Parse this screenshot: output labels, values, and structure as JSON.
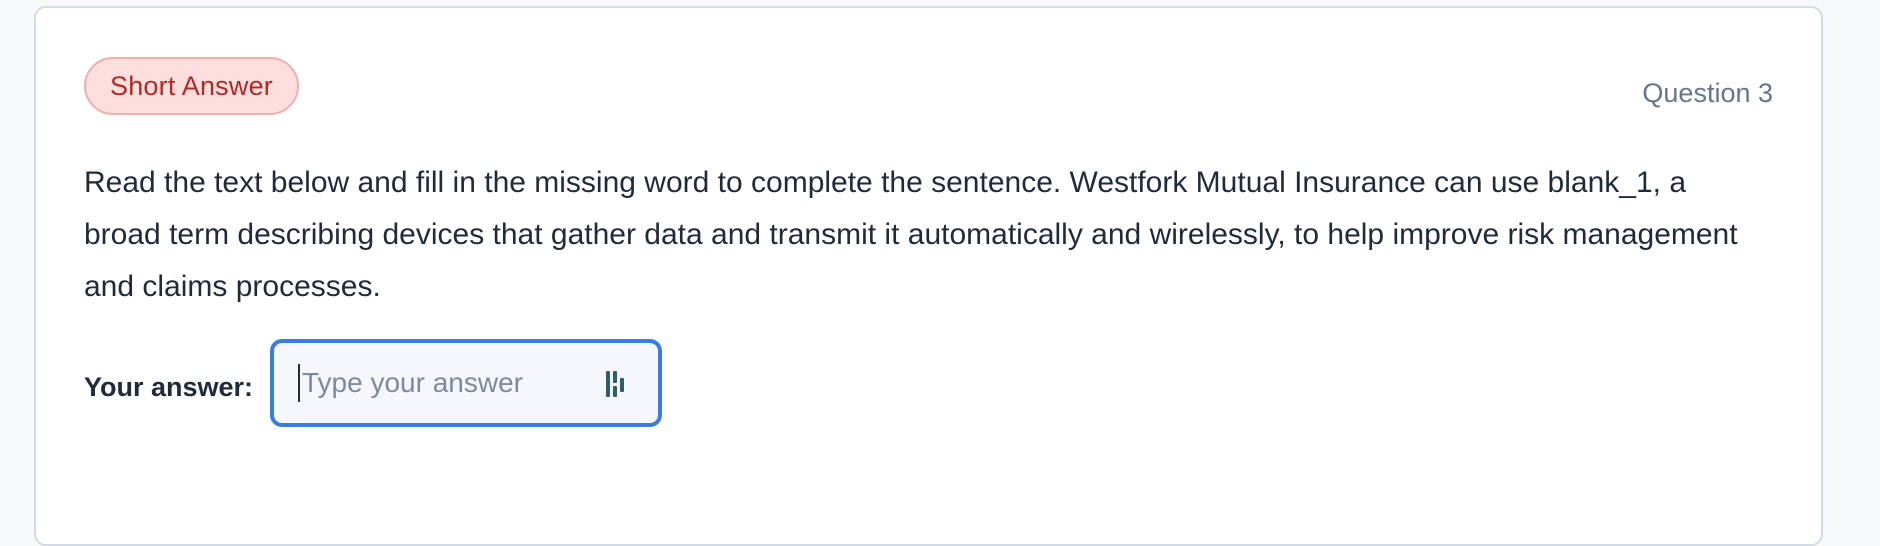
{
  "question": {
    "type_badge": "Short Answer",
    "number_label": "Question 3",
    "prompt": "Read the text below and fill in the missing word to complete the sentence. Westfork Mutual Insurance can use blank_1, a broad term describing devices that gather data and transmit it automatically and wirelessly, to help improve risk management and claims processes."
  },
  "answer": {
    "label": "Your answer:",
    "placeholder": "Type your answer",
    "value": ""
  },
  "icons": {
    "input_addon": "password-manager-icon"
  },
  "colors": {
    "badge_background": "#fbdedd",
    "badge_text": "#b22a24",
    "focus_border": "#3a7de0",
    "icon": "#2f5f6b"
  }
}
